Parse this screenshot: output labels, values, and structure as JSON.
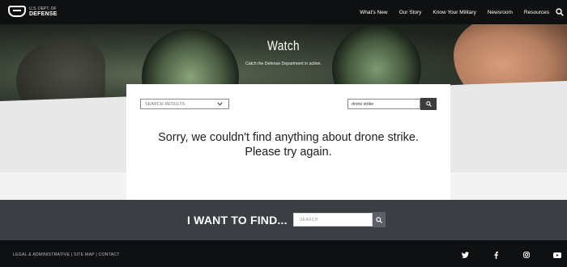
{
  "header": {
    "logo_small": "U.S. DEPT. OF",
    "logo_big": "DEFENSE",
    "nav": [
      "What's New",
      "Our Story",
      "Know Your Military",
      "Newsroom",
      "Resources"
    ]
  },
  "hero": {
    "title": "Watch",
    "subtitle": "Catch the Defense Department in action."
  },
  "results": {
    "filter_selected": "SEARCH RESULTS",
    "search_value": "drone strike",
    "message_line1": "Sorry, we couldn't find anything about drone strike.",
    "message_line2": "Please try again."
  },
  "find": {
    "label": "I WANT TO FIND...",
    "placeholder": "SEARCH"
  },
  "footer": {
    "links": "LEGAL & ADMINISTRATIVE | SITE MAP | CONTACT",
    "social": [
      "twitter-icon",
      "facebook-icon",
      "instagram-icon",
      "youtube-icon"
    ]
  },
  "colors": {
    "nav_bg": "#0f1011",
    "find_band": "#3b3e42",
    "button_dark": "#3b3d3f"
  }
}
